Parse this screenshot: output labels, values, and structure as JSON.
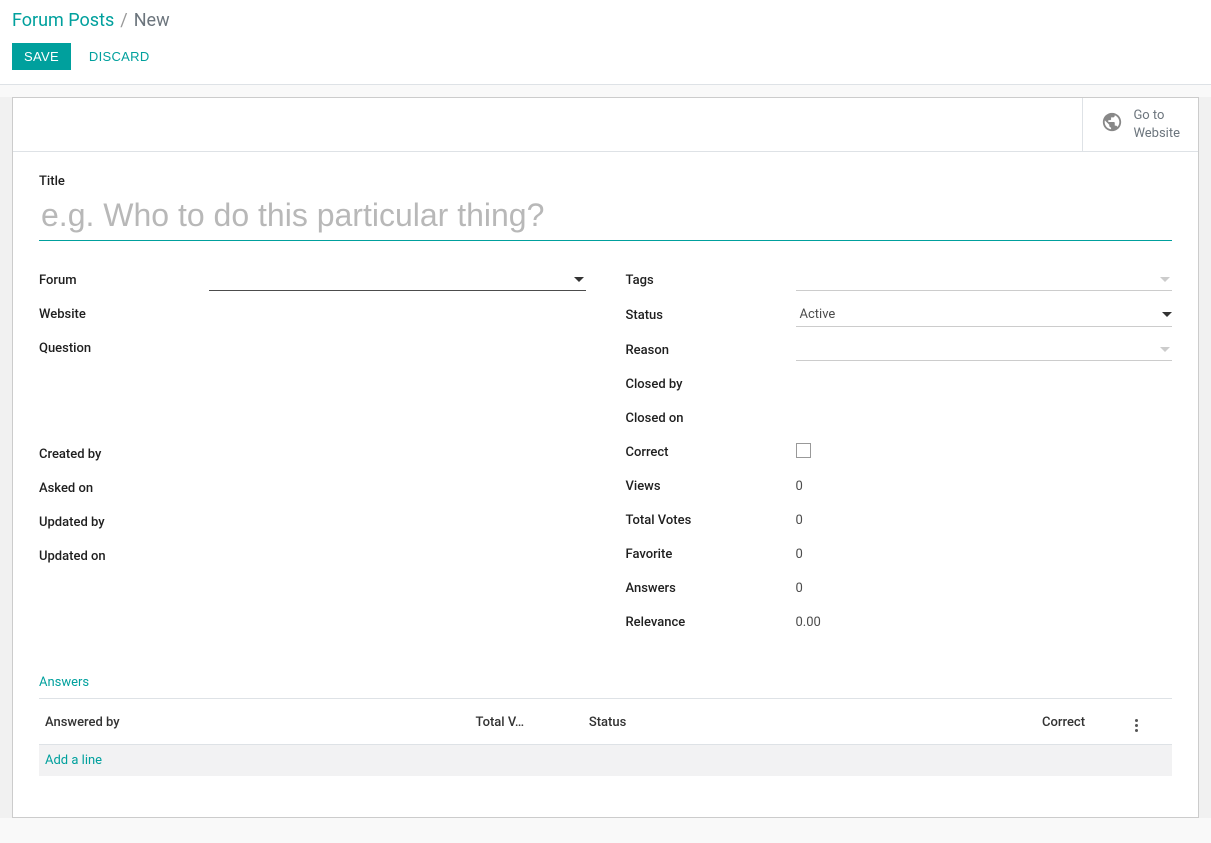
{
  "breadcrumb": {
    "parent": "Forum Posts",
    "current": "New"
  },
  "buttons": {
    "save": "Save",
    "discard": "Discard"
  },
  "topbar": {
    "goto_website": "Go to\nWebsite"
  },
  "form": {
    "title_label": "Title",
    "title_placeholder": "e.g. Who to do this particular thing?",
    "title_value": ""
  },
  "left_fields": {
    "forum": {
      "label": "Forum",
      "value": ""
    },
    "website": {
      "label": "Website",
      "value": ""
    },
    "question": {
      "label": "Question",
      "value": ""
    },
    "created_by": {
      "label": "Created by",
      "value": ""
    },
    "asked_on": {
      "label": "Asked on",
      "value": ""
    },
    "updated_by": {
      "label": "Updated by",
      "value": ""
    },
    "updated_on": {
      "label": "Updated on",
      "value": ""
    }
  },
  "right_fields": {
    "tags": {
      "label": "Tags",
      "value": ""
    },
    "status": {
      "label": "Status",
      "value": "Active"
    },
    "reason": {
      "label": "Reason",
      "value": ""
    },
    "closed_by": {
      "label": "Closed by",
      "value": ""
    },
    "closed_on": {
      "label": "Closed on",
      "value": ""
    },
    "correct": {
      "label": "Correct",
      "checked": false
    },
    "views": {
      "label": "Views",
      "value": "0"
    },
    "total_votes": {
      "label": "Total Votes",
      "value": "0"
    },
    "favorite": {
      "label": "Favorite",
      "value": "0"
    },
    "answers": {
      "label": "Answers",
      "value": "0"
    },
    "relevance": {
      "label": "Relevance",
      "value": "0.00"
    }
  },
  "answers_section": {
    "title": "Answers",
    "columns": {
      "answered_by": "Answered by",
      "total_votes": "Total V…",
      "status": "Status",
      "correct": "Correct"
    },
    "add_line": "Add a line"
  }
}
